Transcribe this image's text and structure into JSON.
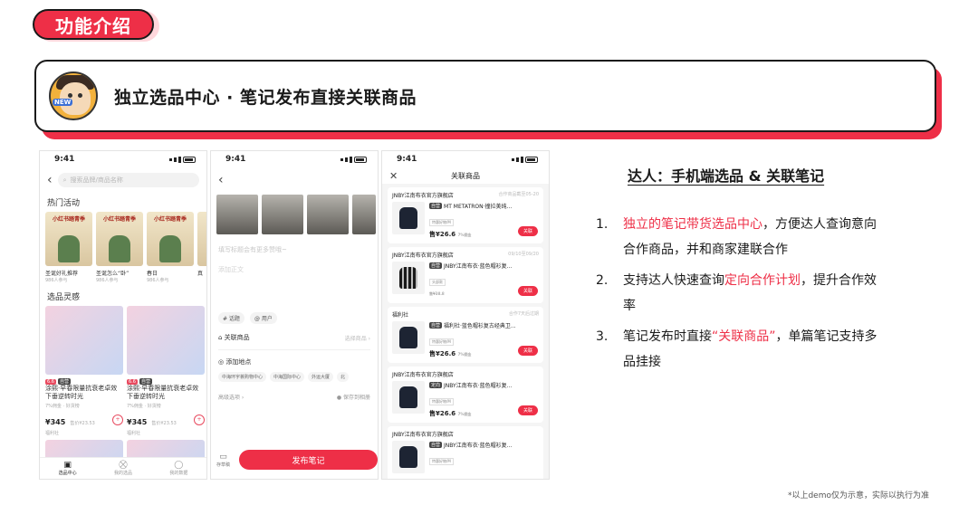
{
  "tag": "功能介绍",
  "banner": {
    "text": "独立选品中心 · 笔记发布直接关联商品",
    "mascot_badge": "NEW"
  },
  "phone1": {
    "time": "9:41",
    "search_placeholder": "搜索品牌/商品名称",
    "hot_title": "热门活动",
    "activities": [
      {
        "banner": "小红书踏青季",
        "name": "圣诞好礼推荐",
        "meta": "986人参与"
      },
      {
        "banner": "小红书踏青季",
        "name": "圣诞怎么“卧”",
        "meta": "986人参与"
      },
      {
        "banner": "小红书踏青季",
        "name": "春日",
        "meta": "986人参与"
      },
      {
        "banner": "",
        "name": "真",
        "meta": ""
      }
    ],
    "select_title": "选品灵感",
    "products": [
      {
        "tag1": "6.6",
        "tag2": "自营",
        "title": "涂熙·早春限量抗衰老卓效下垂逆转时光",
        "sub": "7%佣金 · 好货榜",
        "price": "¥345",
        "orig": "售价¥23.53",
        "seller": "福利社"
      },
      {
        "tag1": "6.6",
        "tag2": "自营",
        "title": "涂熙·早春限量抗衰老卓效下垂逆转时光",
        "sub": "7%佣金 · 好货榜",
        "price": "¥345",
        "orig": "售价¥23.53",
        "seller": "福利社"
      }
    ],
    "tabs": [
      {
        "icon": "▣",
        "label": "选品中心"
      },
      {
        "icon": "⛒",
        "label": "我的选品"
      },
      {
        "icon": "◯",
        "label": "我的数据"
      }
    ]
  },
  "phone2": {
    "time": "9:41",
    "title_placeholder": "填写标题会有更多赞哦~",
    "body_placeholder": "添加正文",
    "chips": [
      "# 话题",
      "@ 用户"
    ],
    "related_label": "关联商品",
    "related_hint": "选择商品 ›",
    "location_label": "添加地点",
    "locations": [
      "中海环宇荟购物中心",
      "中海国际中心",
      "外运大厦",
      "北"
    ],
    "advanced": "高级选项 ›",
    "save_album": "保存到相册",
    "draft": "存草稿",
    "publish": "发布笔记"
  },
  "phone3": {
    "time": "9:41",
    "title": "关联商品",
    "cards": [
      {
        "shop": "JNBY江南布衣官方旗舰店",
        "date": "合作商品截至05-20",
        "label": "自营",
        "name": "MT METATRON·撞拉美纯...",
        "tag": "特惠好物/M",
        "price": "售¥26.6",
        "sub": "7%佣金",
        "btn": "关联"
      },
      {
        "shop": "JNBY江南布衣官方旗舰店",
        "date": "09/10至09/20",
        "label": "自营",
        "name": "JNBY江南布衣·蓝色帽衫复...",
        "tag": "头部款",
        "price": "",
        "sub": "售¥38.8",
        "btn": "关联"
      },
      {
        "shop": "福利社",
        "date": "合作7天后过期",
        "label": "自营",
        "name": "福利社·蓝色帽衫复古经典卫...",
        "tag": "特惠好物/M",
        "price": "售¥26.6",
        "sub": "7%佣金",
        "btn": "关联"
      },
      {
        "shop": "JNBY江南布衣官方旗舰店",
        "date": "",
        "label": "定向",
        "name": "JNBY江南布衣·蓝色帽衫复...",
        "tag": "特惠好物/M",
        "price": "售¥26.6",
        "sub": "7%佣金",
        "btn": "关联"
      },
      {
        "shop": "JNBY江南布衣官方旗舰店",
        "date": "",
        "label": "自营",
        "name": "JNBY江南布衣·蓝色帽衫复...",
        "tag": "特惠好物/M",
        "price": "",
        "sub": "",
        "btn": ""
      }
    ]
  },
  "right": {
    "title": "达人：手机端选品 & 关联笔记",
    "items": [
      {
        "num": "1.",
        "red": "独立的笔记带货选品中心",
        "text": "，方便达人查询意向合作商品，并和商家建联合作"
      },
      {
        "num": "2.",
        "pre": "支持达人快速查询",
        "red": "定向合作计划",
        "post": "，提升合作效率"
      },
      {
        "num": "3.",
        "pre": "笔记发布时直接",
        "red": "“关联商品”",
        "post": "，单篇笔记支持多品挂接"
      }
    ]
  },
  "footnote": "*以上demo仅为示意，实际以执行为准",
  "colors": {
    "accent": "#ee2f47",
    "ink": "#1a1a1a"
  }
}
